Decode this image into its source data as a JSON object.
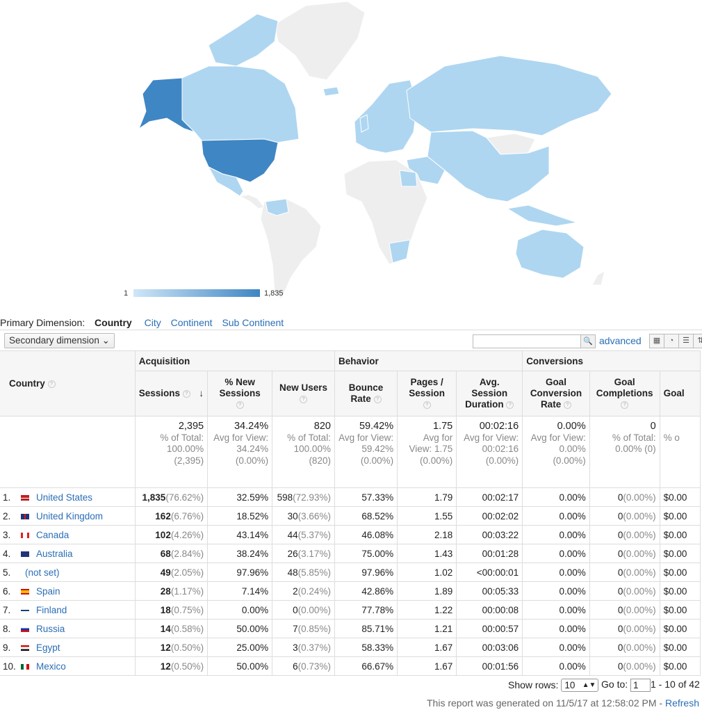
{
  "legend": {
    "min": "1",
    "max": "1,835"
  },
  "dimension": {
    "label": "Primary Dimension:",
    "current": "Country",
    "options": [
      "City",
      "Continent",
      "Sub Continent"
    ]
  },
  "toolbar": {
    "secondary": "Secondary dimension",
    "search_icon": "magnifier-icon",
    "advanced": "advanced"
  },
  "groups": {
    "acquisition": "Acquisition",
    "behavior": "Behavior",
    "conversions": "Conversions"
  },
  "headers": {
    "country": "Country",
    "sessions": "Sessions",
    "new_sessions": "% New Sessions",
    "new_users": "New Users",
    "bounce": "Bounce Rate",
    "pages": "Pages / Session",
    "duration": "Avg. Session Duration",
    "goal_rate": "Goal Conversion Rate",
    "goal_comp": "Goal Completions",
    "goal_value": "Goal"
  },
  "totals": {
    "sessions": "2,395",
    "sessions_sub": "% of Total: 100.00% (2,395)",
    "new_sessions": "34.24%",
    "new_sessions_sub": "Avg for View: 34.24% (0.00%)",
    "new_users": "820",
    "new_users_sub": "% of Total: 100.00% (820)",
    "bounce": "59.42%",
    "bounce_sub": "Avg for View: 59.42% (0.00%)",
    "pages": "1.75",
    "pages_sub": "Avg for View: 1.75 (0.00%)",
    "duration": "00:02:16",
    "duration_sub": "Avg for View: 00:02:16 (0.00%)",
    "goal_rate": "0.00%",
    "goal_rate_sub": "Avg for View: 0.00% (0.00%)",
    "goal_comp": "0",
    "goal_comp_sub": "% of Total: 0.00% (0)",
    "goal_value_sub": "% o"
  },
  "rows": [
    {
      "n": "1.",
      "country": "United States",
      "flag": "us",
      "sessions": "1,835",
      "sessions_pct": "(76.62%)",
      "new_sessions": "32.59%",
      "new_users": "598",
      "new_users_pct": "(72.93%)",
      "bounce": "57.33%",
      "pages": "1.79",
      "duration": "00:02:17",
      "goal_rate": "0.00%",
      "goal_comp": "0",
      "goal_comp_pct": "(0.00%)",
      "goal_value": "$0.00"
    },
    {
      "n": "2.",
      "country": "United Kingdom",
      "flag": "uk",
      "sessions": "162",
      "sessions_pct": "(6.76%)",
      "new_sessions": "18.52%",
      "new_users": "30",
      "new_users_pct": "(3.66%)",
      "bounce": "68.52%",
      "pages": "1.55",
      "duration": "00:02:02",
      "goal_rate": "0.00%",
      "goal_comp": "0",
      "goal_comp_pct": "(0.00%)",
      "goal_value": "$0.00"
    },
    {
      "n": "3.",
      "country": "Canada",
      "flag": "ca",
      "sessions": "102",
      "sessions_pct": "(4.26%)",
      "new_sessions": "43.14%",
      "new_users": "44",
      "new_users_pct": "(5.37%)",
      "bounce": "46.08%",
      "pages": "2.18",
      "duration": "00:03:22",
      "goal_rate": "0.00%",
      "goal_comp": "0",
      "goal_comp_pct": "(0.00%)",
      "goal_value": "$0.00"
    },
    {
      "n": "4.",
      "country": "Australia",
      "flag": "au",
      "sessions": "68",
      "sessions_pct": "(2.84%)",
      "new_sessions": "38.24%",
      "new_users": "26",
      "new_users_pct": "(3.17%)",
      "bounce": "75.00%",
      "pages": "1.43",
      "duration": "00:01:28",
      "goal_rate": "0.00%",
      "goal_comp": "0",
      "goal_comp_pct": "(0.00%)",
      "goal_value": "$0.00"
    },
    {
      "n": "5.",
      "country": "(not set)",
      "flag": "",
      "sessions": "49",
      "sessions_pct": "(2.05%)",
      "new_sessions": "97.96%",
      "new_users": "48",
      "new_users_pct": "(5.85%)",
      "bounce": "97.96%",
      "pages": "1.02",
      "duration": "<00:00:01",
      "goal_rate": "0.00%",
      "goal_comp": "0",
      "goal_comp_pct": "(0.00%)",
      "goal_value": "$0.00"
    },
    {
      "n": "6.",
      "country": "Spain",
      "flag": "es",
      "sessions": "28",
      "sessions_pct": "(1.17%)",
      "new_sessions": "7.14%",
      "new_users": "2",
      "new_users_pct": "(0.24%)",
      "bounce": "42.86%",
      "pages": "1.89",
      "duration": "00:05:33",
      "goal_rate": "0.00%",
      "goal_comp": "0",
      "goal_comp_pct": "(0.00%)",
      "goal_value": "$0.00"
    },
    {
      "n": "7.",
      "country": "Finland",
      "flag": "fi",
      "sessions": "18",
      "sessions_pct": "(0.75%)",
      "new_sessions": "0.00%",
      "new_users": "0",
      "new_users_pct": "(0.00%)",
      "bounce": "77.78%",
      "pages": "1.22",
      "duration": "00:00:08",
      "goal_rate": "0.00%",
      "goal_comp": "0",
      "goal_comp_pct": "(0.00%)",
      "goal_value": "$0.00"
    },
    {
      "n": "8.",
      "country": "Russia",
      "flag": "ru",
      "sessions": "14",
      "sessions_pct": "(0.58%)",
      "new_sessions": "50.00%",
      "new_users": "7",
      "new_users_pct": "(0.85%)",
      "bounce": "85.71%",
      "pages": "1.21",
      "duration": "00:00:57",
      "goal_rate": "0.00%",
      "goal_comp": "0",
      "goal_comp_pct": "(0.00%)",
      "goal_value": "$0.00"
    },
    {
      "n": "9.",
      "country": "Egypt",
      "flag": "eg",
      "sessions": "12",
      "sessions_pct": "(0.50%)",
      "new_sessions": "25.00%",
      "new_users": "3",
      "new_users_pct": "(0.37%)",
      "bounce": "58.33%",
      "pages": "1.67",
      "duration": "00:03:06",
      "goal_rate": "0.00%",
      "goal_comp": "0",
      "goal_comp_pct": "(0.00%)",
      "goal_value": "$0.00"
    },
    {
      "n": "10.",
      "country": "Mexico",
      "flag": "mx",
      "sessions": "12",
      "sessions_pct": "(0.50%)",
      "new_sessions": "50.00%",
      "new_users": "6",
      "new_users_pct": "(0.73%)",
      "bounce": "66.67%",
      "pages": "1.67",
      "duration": "00:01:56",
      "goal_rate": "0.00%",
      "goal_comp": "0",
      "goal_comp_pct": "(0.00%)",
      "goal_value": "$0.00"
    }
  ],
  "footer": {
    "show_rows": "Show rows:",
    "rows_value": "10",
    "go_to": "Go to:",
    "go_value": "1",
    "range": "1 - 10 of 42",
    "generated": "This report was generated on 11/5/17 at 12:58:02 PM -",
    "refresh": "Refresh"
  },
  "colors": {
    "dark": "#3f86c4",
    "light": "#aed6f1",
    "none": "#eeeeee"
  }
}
